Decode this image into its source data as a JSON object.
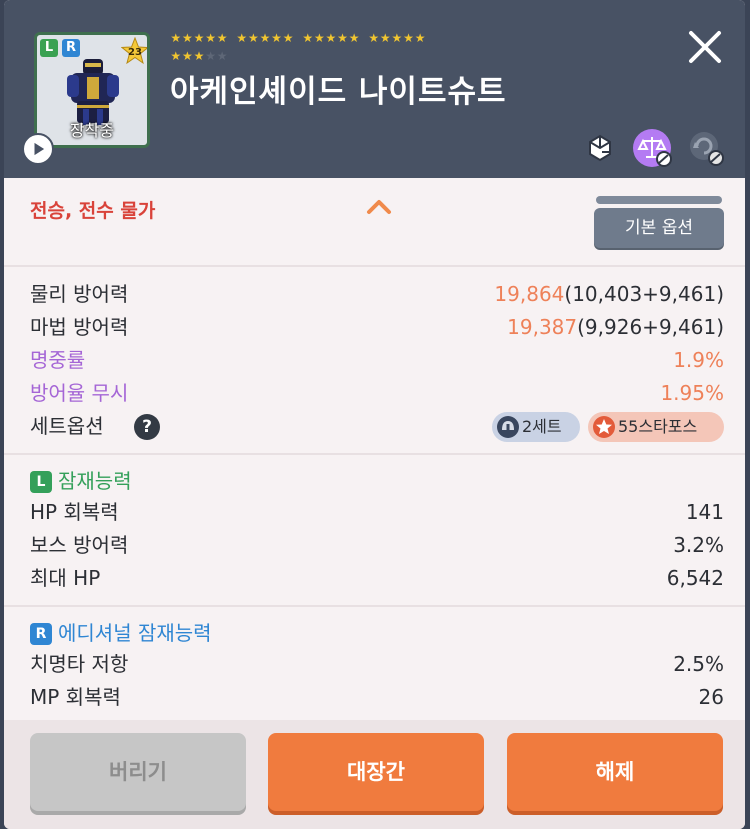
{
  "item": {
    "name": "아케인셰이드 나이트슈트",
    "star_force": 23,
    "star_force_max": 25,
    "equipped_label": "장착중",
    "potential_grade": "L",
    "additional_grade": "R"
  },
  "header_icons": [
    "transfer-icon",
    "scale-disabled-icon",
    "refresh-disabled-icon"
  ],
  "trade": {
    "restriction": "전승, 전수 물가",
    "base_option_button": "기본 옵션"
  },
  "stats": [
    {
      "label": "물리 방어력",
      "total": "19,864",
      "detail": "(10,403+9,461)"
    },
    {
      "label": "마법 방어력",
      "total": "19,387",
      "detail": "(9,926+9,461)"
    },
    {
      "label": "명중률",
      "value": "1.9%"
    },
    {
      "label": "방어율 무시",
      "value": "1.95%"
    }
  ],
  "set_option": {
    "label": "세트옵션",
    "help": "?",
    "badges": [
      "2세트",
      "55스타포스"
    ]
  },
  "potential": {
    "badge": "L",
    "title": "잠재능력",
    "lines": [
      {
        "label": "HP 회복력",
        "value": "141"
      },
      {
        "label": "보스 방어력",
        "value": "3.2%"
      },
      {
        "label": "최대 HP",
        "value": "6,542"
      }
    ]
  },
  "additional": {
    "badge": "R",
    "title": "에디셔널 잠재능력",
    "lines": [
      {
        "label": "치명타 저항",
        "value": "2.5%"
      },
      {
        "label": "MP 회복력",
        "value": "26"
      }
    ]
  },
  "buttons": {
    "discard": "버리기",
    "exchange": "대장간",
    "unequip": "해제"
  },
  "colors": {
    "header_bg": "#485264",
    "panel_bg": "#f7f2f3",
    "orange_value": "#ee8159",
    "purple_label": "#a566d6",
    "restriction_red": "#d9433a",
    "potential_green": "#34a05a",
    "additional_blue": "#2f86d3",
    "primary_button": "#f07b3e",
    "star_gold": "#f0c530"
  }
}
